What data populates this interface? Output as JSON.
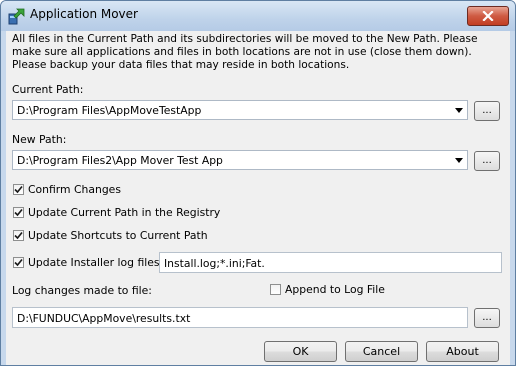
{
  "window": {
    "title": "Application Mover"
  },
  "intro_text": "All files in the Current Path and its subdirectories will be moved to the New Path.  Please make sure all applications and files in both locations are not in use (close them down).  Please backup your data files that may reside in both locations.",
  "current_path": {
    "label": "Current Path:",
    "value": "D:\\Program Files\\AppMoveTestApp",
    "browse_label": "..."
  },
  "new_path": {
    "label": "New Path:",
    "value": "D:\\Program Files2\\App Mover Test App",
    "browse_label": "..."
  },
  "options": {
    "confirm_changes": {
      "label": "Confirm Changes",
      "checked": true
    },
    "update_registry": {
      "label": "Update Current Path in the Registry",
      "checked": true
    },
    "update_shortcuts": {
      "label": "Update Shortcuts to Current Path",
      "checked": true
    },
    "update_installer_logs": {
      "label": "Update Installer log files:",
      "checked": true,
      "value": "Install.log;*.ini;Fat."
    }
  },
  "log": {
    "label": "Log changes made to file:",
    "append_label": "Append to Log File",
    "append_checked": false,
    "value": "D:\\FUNDUC\\AppMove\\results.txt",
    "browse_label": "..."
  },
  "buttons": {
    "ok": "OK",
    "cancel": "Cancel",
    "about": "About"
  }
}
